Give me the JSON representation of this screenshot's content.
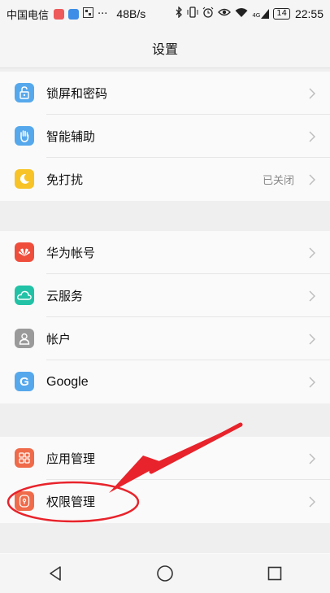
{
  "status_bar": {
    "carrier": "中国电信",
    "speed": "48B/s",
    "battery": "14",
    "time": "22:55",
    "signal_tag": "4G"
  },
  "header": {
    "title": "设置"
  },
  "groups": [
    {
      "items": [
        {
          "label": "锁屏和密码",
          "icon": "lock-screen-icon",
          "color": "#56a8ec"
        },
        {
          "label": "智能辅助",
          "icon": "hand-icon",
          "color": "#56a8ec"
        },
        {
          "label": "免打扰",
          "icon": "moon-icon",
          "color": "#f7c326",
          "value": "已关闭"
        }
      ]
    },
    {
      "items": [
        {
          "label": "华为帐号",
          "icon": "huawei-logo-icon",
          "color": "#ef4e3d"
        },
        {
          "label": "云服务",
          "icon": "cloud-icon",
          "color": "#21c2a6"
        },
        {
          "label": "帐户",
          "icon": "user-icon",
          "color": "#9a9a9a"
        },
        {
          "label": "Google",
          "icon": "google-icon",
          "color": "#56a8ec"
        }
      ]
    },
    {
      "items": [
        {
          "label": "应用管理",
          "icon": "apps-grid-icon",
          "color": "#ef6b4a"
        },
        {
          "label": "权限管理",
          "icon": "permission-shield-icon",
          "color": "#ef6b4a"
        }
      ]
    }
  ],
  "colors": {
    "annotation_red": "#e8232b",
    "chevron": "#bdbdbd"
  }
}
